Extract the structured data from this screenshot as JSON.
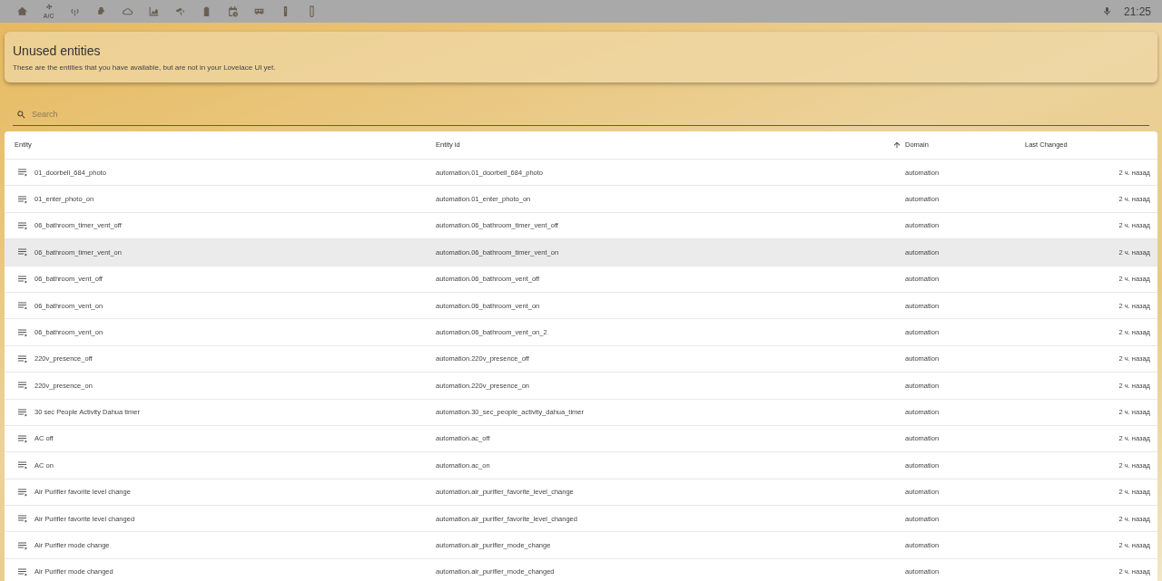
{
  "toolbar": {
    "ac_label": "A/C",
    "clock": "21:25"
  },
  "card": {
    "title": "Unused entities",
    "description": "These are the entities that you have available, but are not in your Lovelace UI yet."
  },
  "search": {
    "placeholder": "Search"
  },
  "table": {
    "columns": [
      {
        "label": "Entity",
        "sorted_ascending": false
      },
      {
        "label": "Entity id",
        "sorted_ascending": false
      },
      {
        "label": "Domain",
        "sorted_ascending": true
      },
      {
        "label": "Last Changed",
        "sorted_ascending": false
      }
    ],
    "rows": [
      {
        "entity": "01_doorbell_684_photo",
        "entity_id": "automation.01_doorbell_684_photo",
        "domain": "automation",
        "last_changed": "2 ч. назад",
        "highlighted": false
      },
      {
        "entity": "01_enter_photo_on",
        "entity_id": "automation.01_enter_photo_on",
        "domain": "automation",
        "last_changed": "2 ч. назад",
        "highlighted": false
      },
      {
        "entity": "06_bathroom_timer_vent_off",
        "entity_id": "automation.06_bathroom_timer_vent_off",
        "domain": "automation",
        "last_changed": "2 ч. назад",
        "highlighted": false
      },
      {
        "entity": "06_bathroom_timer_vent_on",
        "entity_id": "automation.06_bathroom_timer_vent_on",
        "domain": "automation",
        "last_changed": "2 ч. назад",
        "highlighted": true
      },
      {
        "entity": "06_bathroom_vent_off",
        "entity_id": "automation.06_bathroom_vent_off",
        "domain": "automation",
        "last_changed": "2 ч. назад",
        "highlighted": false
      },
      {
        "entity": "06_bathroom_vent_on",
        "entity_id": "automation.06_bathroom_vent_on",
        "domain": "automation",
        "last_changed": "2 ч. назад",
        "highlighted": false
      },
      {
        "entity": "06_bathroom_vent_on",
        "entity_id": "automation.06_bathroom_vent_on_2",
        "domain": "automation",
        "last_changed": "2 ч. назад",
        "highlighted": false
      },
      {
        "entity": "220v_presence_off",
        "entity_id": "automation.220v_presence_off",
        "domain": "automation",
        "last_changed": "2 ч. назад",
        "highlighted": false
      },
      {
        "entity": "220v_presence_on",
        "entity_id": "automation.220v_presence_on",
        "domain": "automation",
        "last_changed": "2 ч. назад",
        "highlighted": false
      },
      {
        "entity": "30 sec People Activity Dahua timer",
        "entity_id": "automation.30_sec_people_activity_dahua_timer",
        "domain": "automation",
        "last_changed": "2 ч. назад",
        "highlighted": false
      },
      {
        "entity": "AC off",
        "entity_id": "automation.ac_off",
        "domain": "automation",
        "last_changed": "2 ч. назад",
        "highlighted": false
      },
      {
        "entity": "AC on",
        "entity_id": "automation.ac_on",
        "domain": "automation",
        "last_changed": "2 ч. назад",
        "highlighted": false
      },
      {
        "entity": "Air Purifier favorite level change",
        "entity_id": "automation.air_purifier_favorite_level_change",
        "domain": "automation",
        "last_changed": "2 ч. назад",
        "highlighted": false
      },
      {
        "entity": "Air Purifier favorite level changed",
        "entity_id": "automation.air_purifier_favorite_level_changed",
        "domain": "automation",
        "last_changed": "2 ч. назад",
        "highlighted": false
      },
      {
        "entity": "Air Purifier mode change",
        "entity_id": "automation.air_purifier_mode_change",
        "domain": "automation",
        "last_changed": "2 ч. назад",
        "highlighted": false
      },
      {
        "entity": "Air Purifier mode changed",
        "entity_id": "automation.air_purifier_mode_changed",
        "domain": "automation",
        "last_changed": "2 ч. назад",
        "highlighted": false
      }
    ]
  }
}
